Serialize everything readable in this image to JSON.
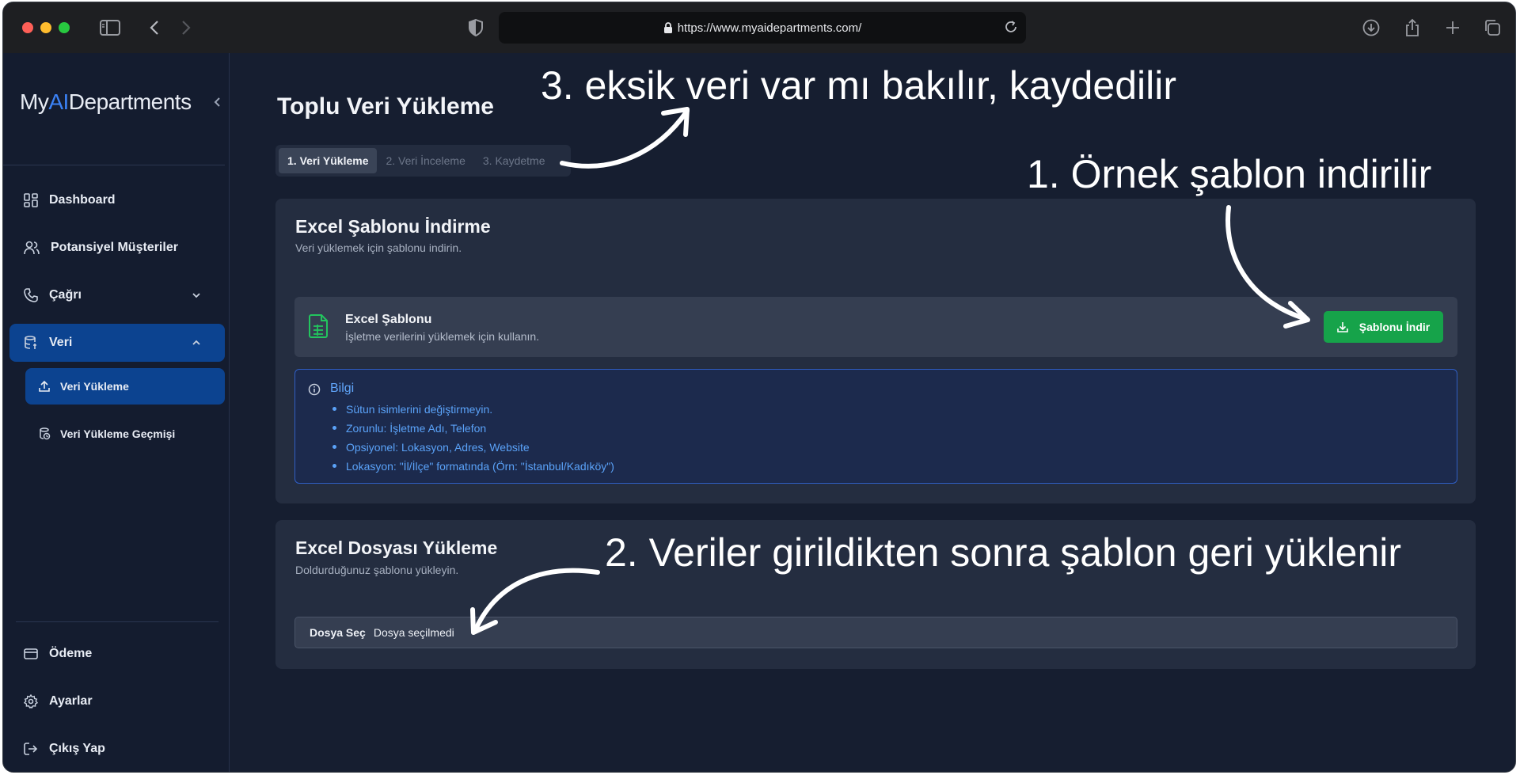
{
  "browser": {
    "url": "https://www.myaidepartments.com/"
  },
  "sidebar": {
    "logo_prefix": "My",
    "logo_ai": "AI",
    "logo_suffix": "Departments",
    "items": [
      {
        "label": "Dashboard",
        "icon": "layout-grid-icon"
      },
      {
        "label": "Potansiyel Müşteriler",
        "icon": "users-icon"
      },
      {
        "label": "Çağrı",
        "icon": "phone-icon"
      },
      {
        "label": "Veri",
        "icon": "database-icon"
      }
    ],
    "sub_items": [
      {
        "label": "Veri Yükleme",
        "icon": "upload-icon"
      },
      {
        "label": "Veri Yükleme Geçmişi",
        "icon": "history-icon"
      }
    ],
    "bottom_items": [
      {
        "label": "Ödeme",
        "icon": "credit-card-icon"
      },
      {
        "label": "Ayarlar",
        "icon": "gear-icon"
      },
      {
        "label": "Çıkış Yap",
        "icon": "logout-icon"
      }
    ]
  },
  "main": {
    "title": "Toplu Veri Yükleme",
    "tabs": [
      "1. Veri Yükleme",
      "2. Veri İnceleme",
      "3. Kaydetme"
    ],
    "template_card": {
      "title": "Excel Şablonu İndirme",
      "subtitle": "Veri yüklemek için şablonu indirin.",
      "file_title": "Excel Şablonu",
      "file_desc": "İşletme verilerini yüklemek için kullanın.",
      "download_label": "Şablonu İndir",
      "info_title": "Bilgi",
      "info_items": [
        "Sütun isimlerini değiştirmeyin.",
        "Zorunlu: İşletme Adı, Telefon",
        "Opsiyonel: Lokasyon, Adres, Website",
        "Lokasyon: \"İl/İlçe\" formatında (Örn: \"İstanbul/Kadıköy\")"
      ]
    },
    "upload_card": {
      "title": "Excel Dosyası Yükleme",
      "subtitle": "Doldurduğunuz şablonu yükleyin.",
      "choose_label": "Dosya Seç",
      "no_file": "Dosya seçilmedi"
    }
  },
  "annotations": {
    "step1": "1. Örnek şablon indirilir",
    "step2": "2. Veriler girildikten sonra şablon geri yüklenir",
    "step3": "3. eksik veri var mı bakılır, kaydedilir"
  },
  "colors": {
    "accent": "#0c4390",
    "download_button": "#16a34a",
    "info_text": "#5aa2f8"
  }
}
